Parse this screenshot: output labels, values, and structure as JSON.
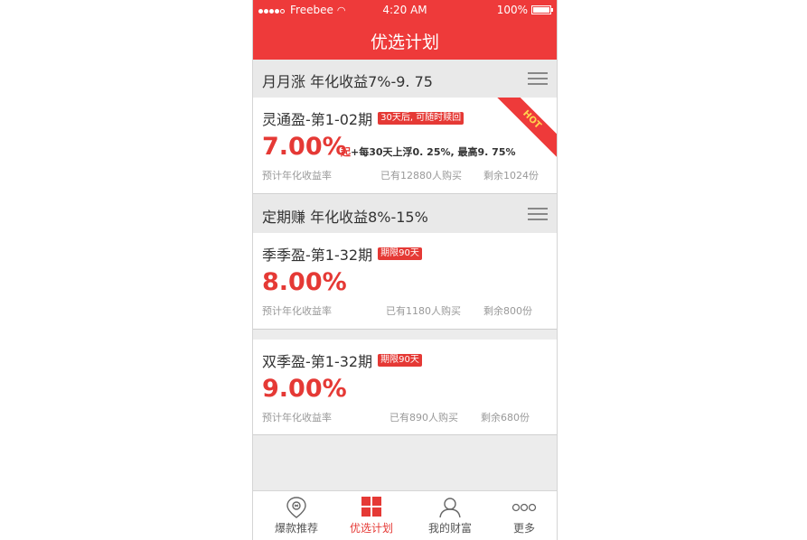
{
  "status_bar": {
    "carrier": "Freebee",
    "time": "4:20 AM",
    "battery": "100%"
  },
  "header": {
    "title": "优选计划"
  },
  "sections": [
    {
      "title": "月月涨  年化收益7%-9. 75"
    },
    {
      "title": "定期赚  年化收益8%-15%"
    }
  ],
  "products": [
    {
      "name": "灵通盈-第1-02期",
      "tag": "30天后, 可随时赎回",
      "rate": "7.00%",
      "extra_start": "起",
      "extra_text": "+每30天上浮0. 25%, 最高9. 75%",
      "rate_label": "预计年化收益率",
      "buyers": "已有12880人购买",
      "remaining": "剩余1024份",
      "badge": "HOT"
    },
    {
      "name": "季季盈-第1-32期",
      "tag": "期限90天",
      "rate": "8.00%",
      "rate_label": "预计年化收益率",
      "buyers": "已有1180人购买",
      "remaining": "剩余800份"
    },
    {
      "name": "双季盈-第1-32期",
      "tag": "期限90天",
      "rate": "9.00%",
      "rate_label": "预计年化收益率",
      "buyers": "已有890人购买",
      "remaining": "剩余680份"
    }
  ],
  "tabs": [
    {
      "label": "爆款推荐",
      "icon": "hot-pick-icon"
    },
    {
      "label": "优选计划",
      "icon": "grid-icon",
      "active": true
    },
    {
      "label": "我的财富",
      "icon": "user-icon"
    },
    {
      "label": "更多",
      "icon": "more-dots-icon"
    }
  ],
  "colors": {
    "primary": "#ee3a3a",
    "rate": "#e53935",
    "background": "#ececec"
  }
}
